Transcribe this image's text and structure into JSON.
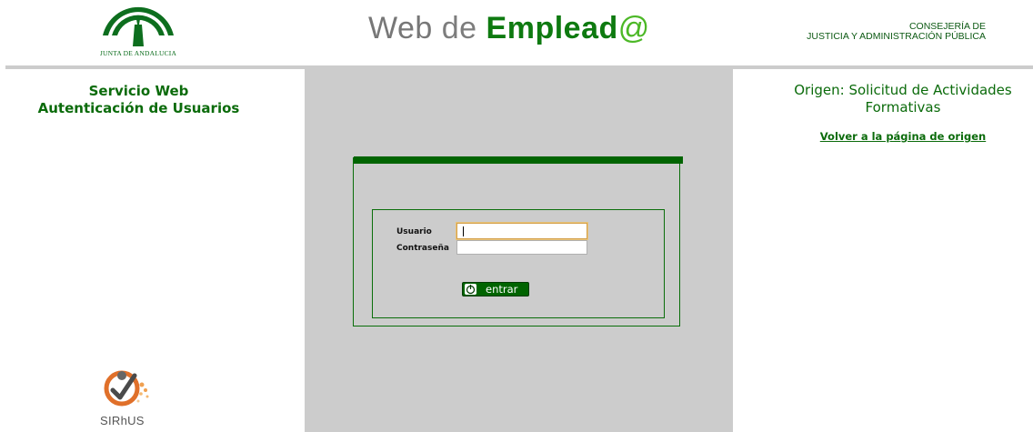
{
  "header": {
    "logo_text": "JUNTA DE ANDALUCIA",
    "title_web": "Web",
    "title_de": "de",
    "title_emplead": "Emplead",
    "title_at": "@",
    "consejeria_line1": "CONSEJERÍA DE",
    "consejeria_line2": "JUSTICIA Y ADMINISTRACIÓN PÚBLICA"
  },
  "left": {
    "service_line1": "Servicio Web",
    "service_line2": "Autenticación de Usuarios",
    "sirhus_text": "SIRhUS"
  },
  "login": {
    "usuario_label": "Usuario",
    "usuario_value": "",
    "password_label": "Contraseña",
    "password_value": "",
    "submit_label": "entrar"
  },
  "right": {
    "origin_line1": "Origen: Solicitud de Actividades",
    "origin_line2": "Formativas",
    "back_link": "Volver a la página de origen"
  },
  "colors": {
    "brand_green": "#006400",
    "text_green": "#0b6b0b",
    "panel_gray": "#cccccc",
    "at_green": "#4cb826"
  },
  "icons": {
    "logo": "junta-andalucia-logo",
    "power": "power-icon",
    "sirhus": "sirhus-logo"
  }
}
